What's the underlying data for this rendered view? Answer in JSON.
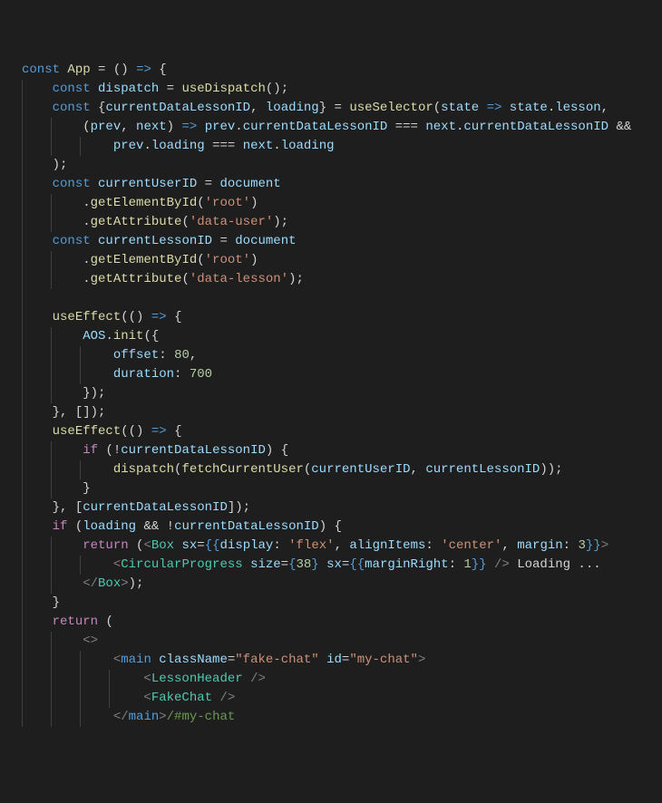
{
  "code": {
    "t": {
      "const": "const",
      "return": "return",
      "if": "if"
    },
    "l1": {
      "App": "App"
    },
    "l2": {
      "dispatch": "dispatch",
      "useDispatch": "useDispatch"
    },
    "l3": {
      "currentDataLessonID": "currentDataLessonID",
      "loading": "loading",
      "useSelector": "useSelector",
      "state": "state",
      "lesson": "lesson"
    },
    "l4": {
      "prev": "prev",
      "next": "next",
      "currentDataLessonID": "currentDataLessonID"
    },
    "l5": {
      "prev": "prev",
      "loading": "loading",
      "next": "next"
    },
    "l7": {
      "currentUserID": "currentUserID",
      "document": "document"
    },
    "l8": {
      "getElementById": "getElementById",
      "root": "'root'"
    },
    "l9": {
      "getAttribute": "getAttribute",
      "dataUser": "'data-user'"
    },
    "l10": {
      "currentLessonID": "currentLessonID",
      "document": "document"
    },
    "l11": {
      "getElementById": "getElementById",
      "root": "'root'"
    },
    "l12": {
      "getAttribute": "getAttribute",
      "dataLesson": "'data-lesson'"
    },
    "l14": {
      "useEffect": "useEffect"
    },
    "l15": {
      "AOS": "AOS",
      "init": "init"
    },
    "l16": {
      "offset": "offset",
      "v": "80"
    },
    "l17": {
      "duration": "duration",
      "v": "700"
    },
    "l20": {
      "useEffect": "useEffect"
    },
    "l21": {
      "currentDataLessonID": "currentDataLessonID"
    },
    "l22": {
      "dispatch": "dispatch",
      "fetchCurrentUser": "fetchCurrentUser",
      "currentUserID": "currentUserID",
      "currentLessonID": "currentLessonID"
    },
    "l24": {
      "currentDataLessonID": "currentDataLessonID"
    },
    "l25": {
      "loading": "loading",
      "currentDataLessonID": "currentDataLessonID"
    },
    "l26": {
      "Box": "Box",
      "sx": "sx",
      "display": "display",
      "flex": "'flex'",
      "alignItems": "alignItems",
      "center": "'center'",
      "margin": "margin",
      "v3": "3"
    },
    "l27": {
      "CircularProgress": "CircularProgress",
      "size": "size",
      "v38": "38",
      "sx": "sx",
      "marginRight": "marginRight",
      "v1": "1",
      "loading": " Loading ..."
    },
    "l28": {
      "Box": "Box"
    },
    "l32": {
      "main": "main",
      "className": "className",
      "fakeChat": "\"fake-chat\"",
      "id": "id",
      "myChat": "\"my-chat\""
    },
    "l33": {
      "LessonHeader": "LessonHeader"
    },
    "l34": {
      "FakeChat": "FakeChat"
    },
    "l35": {
      "main": "main",
      "cmt": "/#my-chat"
    }
  }
}
